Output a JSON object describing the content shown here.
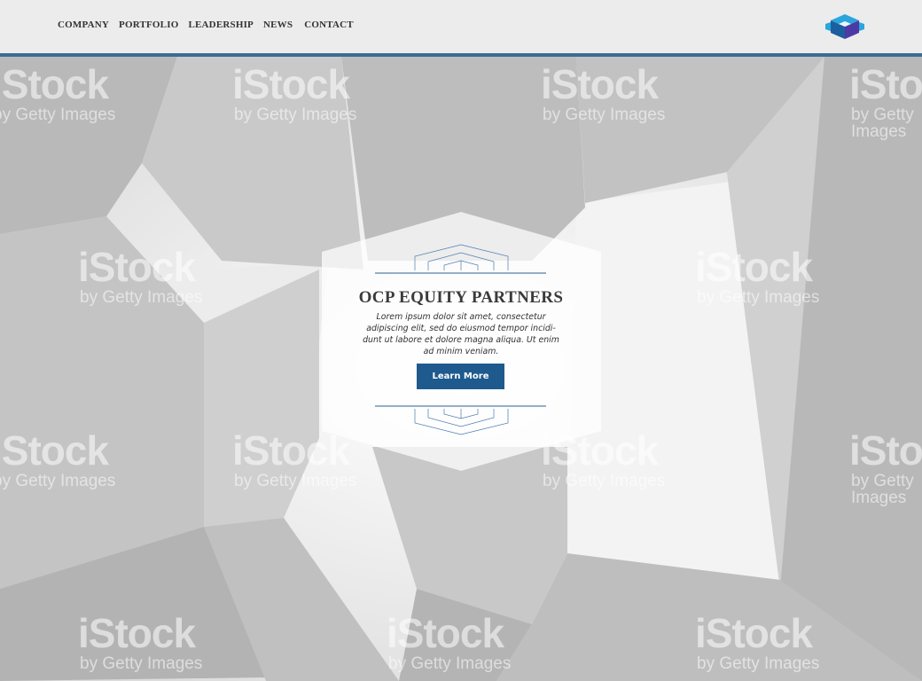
{
  "nav": {
    "items": [
      {
        "label": "COMPANY"
      },
      {
        "label": "PORTFOLIO"
      },
      {
        "label": "LEADERSHIP"
      },
      {
        "label": "NEWS"
      },
      {
        "label": "CONTACT"
      }
    ]
  },
  "logo": {
    "icon": "cube-logo-icon",
    "colors": [
      "#2a9fd8",
      "#1b4f8a",
      "#5a3aa0"
    ]
  },
  "hero": {
    "title": "OCP EQUITY PARTNERS",
    "body": "Lorem ipsum dolor sit amet, consectetur adipiscing elit, sed do eiusmod tempor incidi-dunt ut labore et dolore magna aliqua. Ut enim ad minim veniam.",
    "button_label": "Learn More",
    "accent_color": "#1f5a8e"
  },
  "watermark": {
    "brand": "iStock",
    "sub": "by Getty Images"
  }
}
